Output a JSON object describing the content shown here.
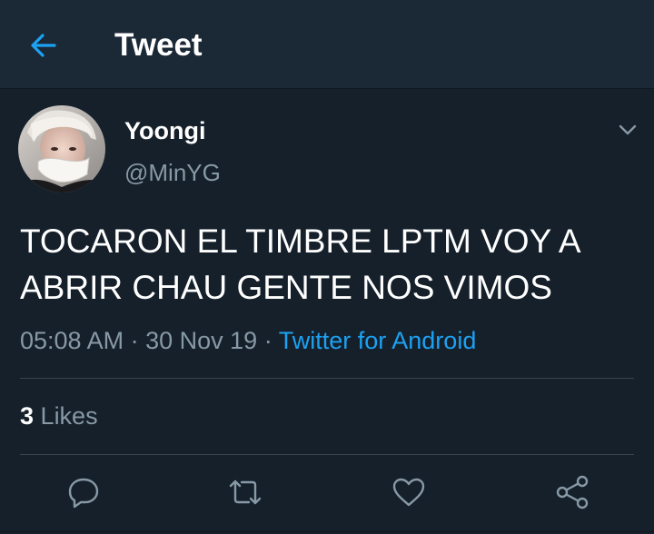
{
  "header": {
    "title": "Tweet",
    "back_icon": "arrow-left-icon"
  },
  "author": {
    "display_name": "Yoongi",
    "handle": "@MinYG"
  },
  "tweet": {
    "text": "TOCARON EL TIMBRE LPTM VOY A ABRIR CHAU GENTE NOS VIMOS",
    "time": "05:08 AM",
    "date": "30 Nov 19",
    "separator": "·",
    "source": "Twitter for Android"
  },
  "stats": {
    "likes_count": "3",
    "likes_label": "Likes"
  },
  "actions": [
    "reply-icon",
    "retweet-icon",
    "heart-icon",
    "share-icon"
  ],
  "colors": {
    "background": "#15202b",
    "header_background": "#1b2836",
    "accent": "#1da1f2",
    "secondary_text": "#8899a6",
    "divider": "#38444d"
  }
}
